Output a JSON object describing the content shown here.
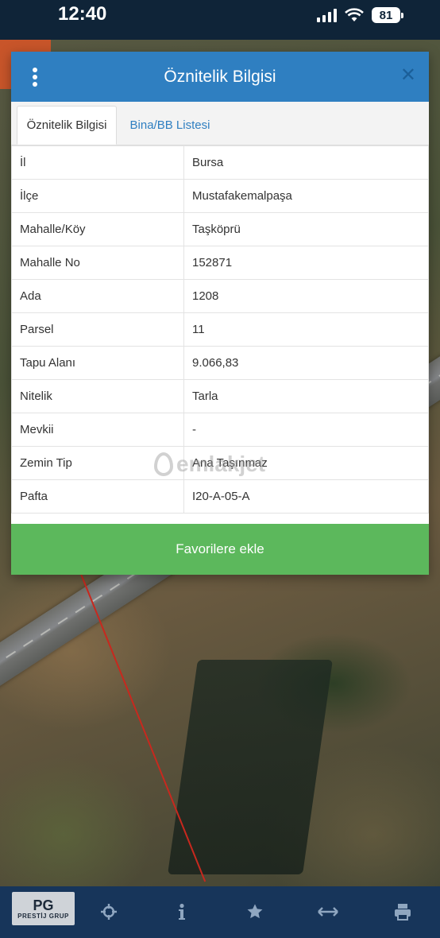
{
  "status_bar": {
    "time": "12:40",
    "battery": "81",
    "icons": [
      "signal-icon",
      "wifi-icon",
      "battery-icon"
    ]
  },
  "modal": {
    "title": "Öznitelik Bilgisi",
    "menu_icon": "kebab-menu-icon",
    "close_icon": "close-icon",
    "tabs": [
      {
        "label": "Öznitelik Bilgisi",
        "active": true
      },
      {
        "label": "Bina/BB Listesi",
        "active": false
      }
    ],
    "rows": [
      {
        "key": "İl",
        "value": "Bursa"
      },
      {
        "key": "İlçe",
        "value": "Mustafakemalpaşa"
      },
      {
        "key": "Mahalle/Köy",
        "value": "Taşköprü"
      },
      {
        "key": "Mahalle No",
        "value": "152871"
      },
      {
        "key": "Ada",
        "value": "1208"
      },
      {
        "key": "Parsel",
        "value": "11"
      },
      {
        "key": "Tapu Alanı",
        "value": "9.066,83"
      },
      {
        "key": "Nitelik",
        "value": "Tarla"
      },
      {
        "key": "Mevkii",
        "value": "-"
      },
      {
        "key": "Zemin Tip",
        "value": "Ana Taşınmaz"
      },
      {
        "key": "Pafta",
        "value": "I20-A-05-A"
      }
    ],
    "favorite_button": "Favorilere ekle"
  },
  "watermark": "emlakjet",
  "bottom_bar": {
    "logo_mark": "PG",
    "logo_text": "PRESTİJ GRUP",
    "tools": [
      "crosshair-icon",
      "info-icon",
      "star-icon",
      "measure-arrows-icon",
      "print-icon"
    ]
  },
  "colors": {
    "header_blue": "#2f7fc1",
    "button_green": "#5cb85c",
    "bottom_bar": "#17355a"
  }
}
